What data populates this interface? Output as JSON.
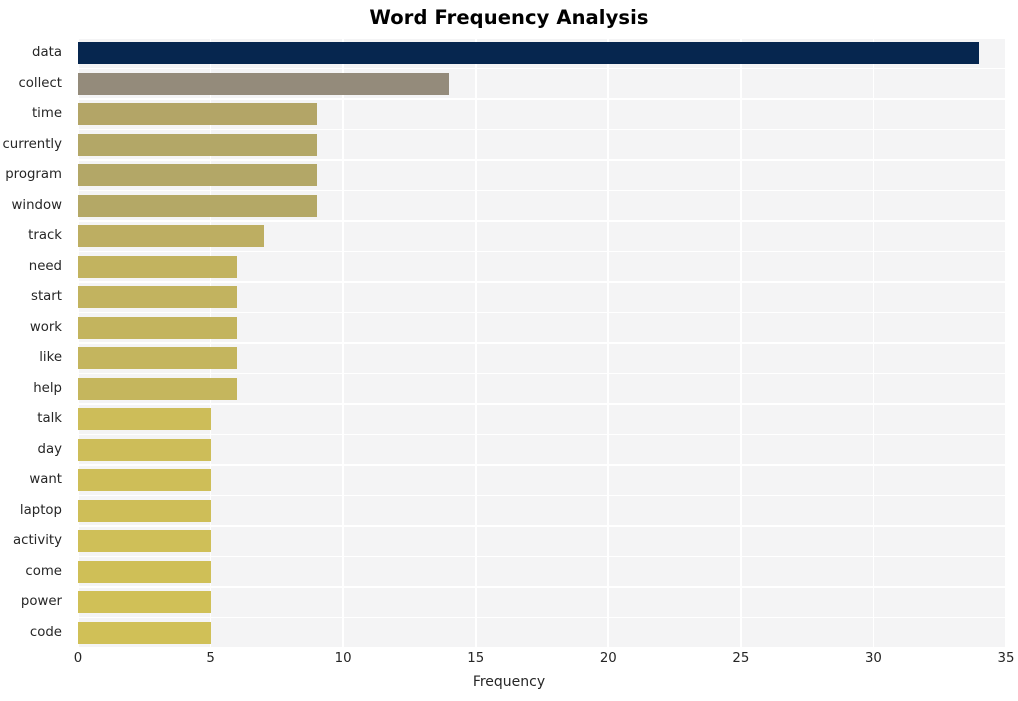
{
  "chart_data": {
    "type": "bar",
    "orientation": "horizontal",
    "title": "Word Frequency Analysis",
    "xlabel": "Frequency",
    "ylabel": "",
    "categories": [
      "data",
      "collect",
      "time",
      "currently",
      "program",
      "window",
      "track",
      "need",
      "start",
      "work",
      "like",
      "help",
      "talk",
      "day",
      "want",
      "laptop",
      "activity",
      "come",
      "power",
      "code"
    ],
    "values": [
      34,
      14,
      9,
      9,
      9,
      9,
      7,
      6,
      6,
      6,
      6,
      6,
      5,
      5,
      5,
      5,
      5,
      5,
      5,
      5
    ],
    "bar_colors": [
      "#06264f",
      "#948b7b",
      "#b3a567",
      "#b3a767",
      "#b3a767",
      "#b4a866",
      "#bdae62",
      "#c2b35f",
      "#c2b35f",
      "#c3b45e",
      "#c4b55e",
      "#c5b65d",
      "#cdbd59",
      "#cdbd59",
      "#cebe58",
      "#cebe58",
      "#cfbf58",
      "#cfbf57",
      "#d0c057",
      "#d0c057"
    ],
    "xlim": [
      0,
      35
    ],
    "xticks": [
      0,
      5,
      10,
      15,
      20,
      25,
      30,
      35
    ],
    "xtick_labels": [
      "0",
      "5",
      "10",
      "15",
      "20",
      "25",
      "30",
      "35"
    ],
    "grid": true,
    "grid_color": "#ffffff",
    "plot_background": "#f4f4f5",
    "figure_background": "#ffffff",
    "legend": null,
    "annotations": []
  }
}
